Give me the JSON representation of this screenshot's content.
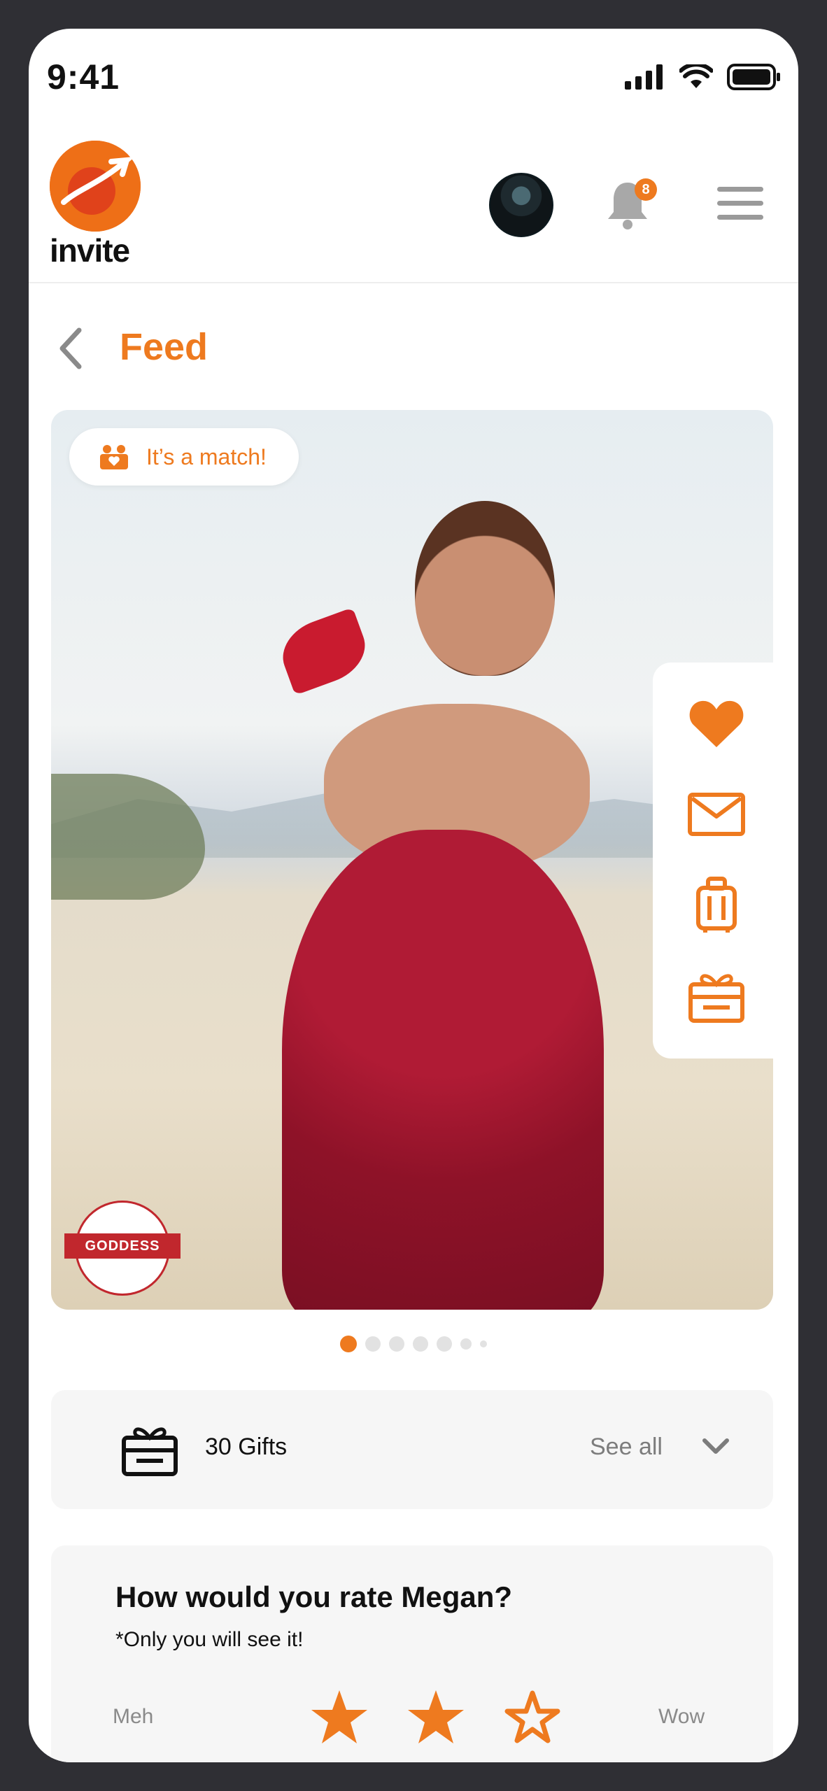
{
  "status_bar": {
    "time": "9:41"
  },
  "header": {
    "logo_text": "invite",
    "notification_count": "8",
    "brand_color": "#EE7A1F"
  },
  "page": {
    "title": "Feed"
  },
  "card": {
    "match_label": "It’s a match!",
    "badge_text": "GODDESS",
    "carousel_total": 7,
    "carousel_active": 0
  },
  "actions": [
    "heart-icon",
    "mail-icon",
    "luggage-icon",
    "gift-icon"
  ],
  "gifts": {
    "label": "30 Gifts",
    "see_all": "See all"
  },
  "rating": {
    "question": "How would you rate  Megan?",
    "note": "*Only you will see it!",
    "low_label": "Meh",
    "high_label": "Wow",
    "stars_filled": 2,
    "stars_total": 3
  }
}
